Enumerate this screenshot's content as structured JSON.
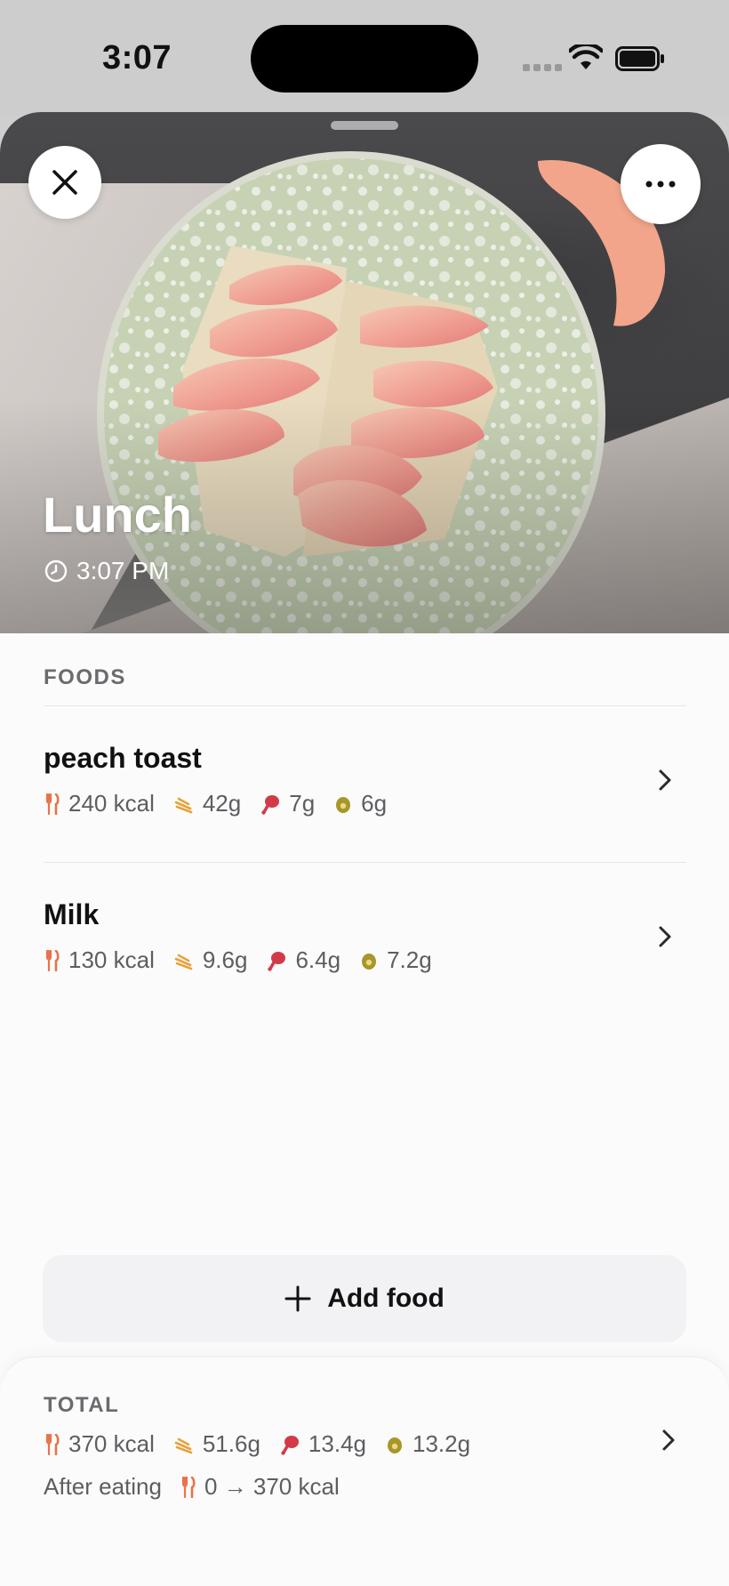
{
  "status_bar": {
    "time": "3:07"
  },
  "header": {
    "title": "Lunch",
    "time": "3:07 PM"
  },
  "foods_section": {
    "label": "FOODS",
    "items": [
      {
        "name": "peach toast",
        "kcal": "240 kcal",
        "carbs": "42g",
        "protein": "7g",
        "fat": "6g"
      },
      {
        "name": "Milk",
        "kcal": "130 kcal",
        "carbs": "9.6g",
        "protein": "6.4g",
        "fat": "7.2g"
      }
    ]
  },
  "add_food": {
    "label": "Add food"
  },
  "totals": {
    "label": "TOTAL",
    "kcal": "370 kcal",
    "carbs": "51.6g",
    "protein": "13.4g",
    "fat": "13.2g",
    "after_label": "After eating",
    "after_value": "0 → 370 kcal"
  },
  "colors": {
    "calories": "#e8734a",
    "carbs": "#e8a23a",
    "protein": "#d23a4a",
    "fat": "#a8962a"
  },
  "icons": {
    "close": "close-icon",
    "more": "more-icon",
    "clock": "clock-icon",
    "calories": "fork-knife-icon",
    "carbs": "wheat-icon",
    "protein": "drumstick-icon",
    "fat": "avocado-icon",
    "chevron": "chevron-right-icon",
    "add": "plus-icon"
  }
}
